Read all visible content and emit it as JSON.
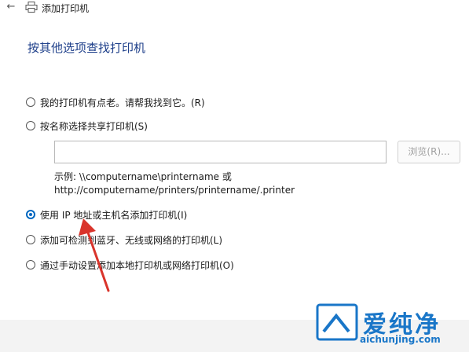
{
  "window": {
    "title": "添加打印机"
  },
  "heading": "按其他选项查找打印机",
  "options": [
    {
      "label": "我的打印机有点老。请帮我找到它。(R)",
      "selected": false
    },
    {
      "label": "按名称选择共享打印机(S)",
      "selected": false
    },
    {
      "label": "使用 IP 地址或主机名添加打印机(I)",
      "selected": true
    },
    {
      "label": "添加可检测到蓝牙、无线或网络的打印机(L)",
      "selected": false
    },
    {
      "label": "通过手动设置添加本地打印机或网络打印机(O)",
      "selected": false
    }
  ],
  "share_input": {
    "value": ""
  },
  "browse_label": "浏览(R)...",
  "example_line1": "示例: \\\\computername\\printername 或",
  "example_line2": "http://computername/printers/printername/.printer",
  "watermark": {
    "name": "爱纯净",
    "url": "aichunjing.com"
  },
  "colors": {
    "accent": "#0067c0",
    "heading": "#1e3f8a",
    "arrow": "#d9342b",
    "watermark": "#1976c8"
  }
}
